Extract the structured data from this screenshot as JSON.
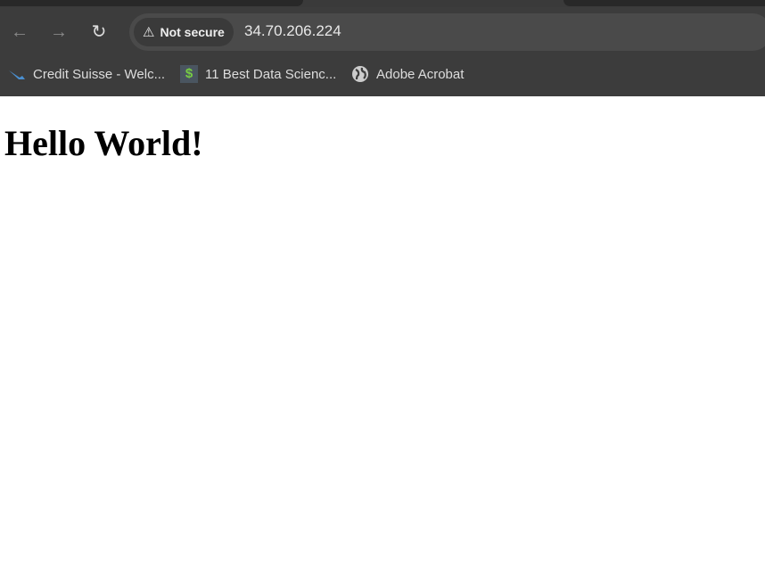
{
  "browser": {
    "security_label": "Not secure",
    "url": "34.70.206.224",
    "bookmarks": [
      {
        "label": "Credit Suisse - Welc...",
        "icon": "credit-suisse-icon"
      },
      {
        "label": "11 Best Data Scienc...",
        "icon": "dollar-icon"
      },
      {
        "label": "Adobe Acrobat",
        "icon": "globe-icon"
      }
    ]
  },
  "page": {
    "heading": "Hello World!"
  }
}
